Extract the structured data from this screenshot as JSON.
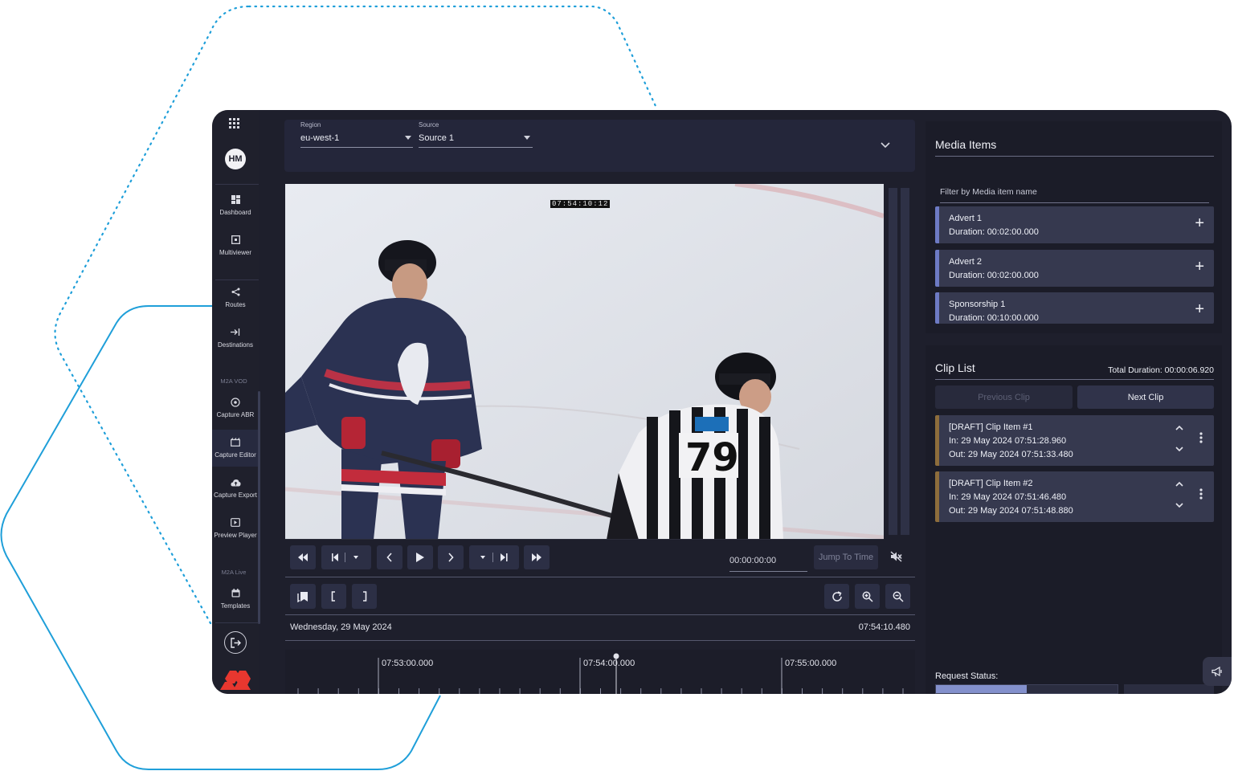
{
  "sidebar": {
    "avatar_initials": "HM",
    "items": [
      {
        "label": "Dashboard",
        "icon": "dashboard-icon"
      },
      {
        "label": "Multiviewer",
        "icon": "multiviewer-icon"
      },
      {
        "label": "Routes",
        "icon": "share-icon"
      },
      {
        "label": "Destinations",
        "icon": "arrow-to-line-icon"
      },
      {
        "label": "Capture ABR",
        "icon": "capture-icon"
      },
      {
        "label": "Capture Editor",
        "icon": "editor-icon"
      },
      {
        "label": "Capture Export",
        "icon": "cloud-upload-icon"
      },
      {
        "label": "Preview Player",
        "icon": "play-box-icon"
      },
      {
        "label": "Templates",
        "icon": "calendar-icon"
      }
    ],
    "section_vod": "M2A VOD",
    "section_live": "M2A Live",
    "active_item": "Capture Editor"
  },
  "selectors": {
    "region_label": "Region",
    "region_value": "eu-west-1",
    "source_label": "Source",
    "source_value": "Source 1"
  },
  "video": {
    "timecode_overlay": "07:54:10:12"
  },
  "transport": {
    "time_value": "00:00:00:00",
    "jump_label": "Jump To Time"
  },
  "timeline": {
    "date": "Wednesday, 29 May 2024",
    "current_time": "07:54:10.480",
    "ticks": [
      "07:53:00.000",
      "07:54:00.000",
      "07:55:00.000"
    ]
  },
  "media_items": {
    "title": "Media Items",
    "filter_placeholder": "Filter by Media item name",
    "items": [
      {
        "name": "Advert 1",
        "duration": "Duration: 00:02:00.000"
      },
      {
        "name": "Advert 2",
        "duration": "Duration: 00:02:00.000"
      },
      {
        "name": "Sponsorship 1",
        "duration": "Duration: 00:10:00.000"
      }
    ]
  },
  "clip_list": {
    "title": "Clip List",
    "total_duration": "Total Duration: 00:00:06.920",
    "prev_label": "Previous Clip",
    "next_label": "Next Clip",
    "items": [
      {
        "name": "[DRAFT] Clip Item #1",
        "in": "In: 29 May 2024 07:51:28.960",
        "out": "Out: 29 May 2024 07:51:33.480"
      },
      {
        "name": "[DRAFT] Clip Item #2",
        "in": "In: 29 May 2024 07:51:46.480",
        "out": "Out: 29 May 2024 07:51:48.880"
      }
    ],
    "request_status_label": "Request Status:",
    "request_progress": 0.5
  },
  "colors": {
    "accent_media": "#6d7ac4",
    "accent_clip": "#8d6d3c",
    "decor_line": "#1f9fd9"
  }
}
